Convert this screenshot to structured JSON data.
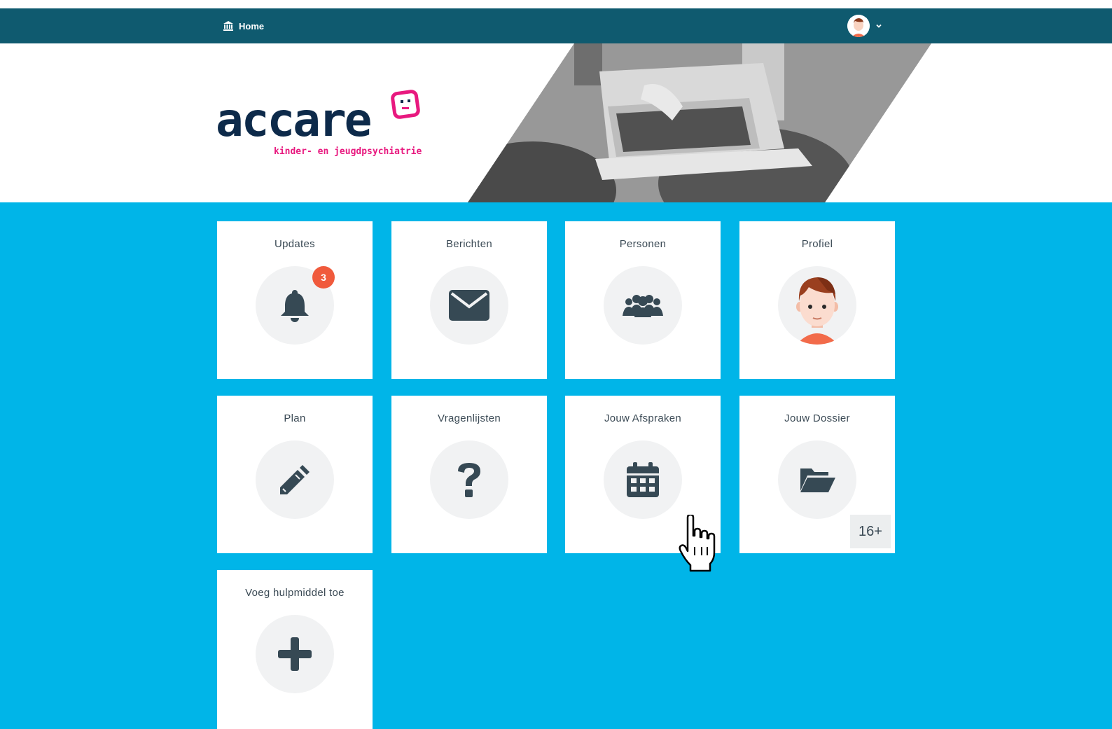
{
  "nav": {
    "home_label": "Home",
    "home_icon": "building-icon",
    "account_icon": "avatar-icon",
    "dropdown_icon": "chevron-down-icon",
    "bg_color": "#0f5a6f"
  },
  "brand": {
    "logo_text": "accare",
    "tagline": "kinder- en jeugdpsychiatrie",
    "primary_color": "#0d2a4a",
    "accent_color": "#e8197f"
  },
  "main": {
    "bg_color": "#00b5e8",
    "tiles": [
      {
        "title": "Updates",
        "icon": "bell-icon",
        "badge": "3"
      },
      {
        "title": "Berichten",
        "icon": "envelope-icon"
      },
      {
        "title": "Personen",
        "icon": "people-group-icon"
      },
      {
        "title": "Profiel",
        "icon": "profile-avatar-icon"
      },
      {
        "title": "Plan",
        "icon": "pencil-icon"
      },
      {
        "title": "Vragenlijsten",
        "icon": "question-icon"
      },
      {
        "title": "Jouw Afspraken",
        "icon": "calendar-icon"
      },
      {
        "title": "Jouw Dossier",
        "icon": "folder-open-icon",
        "age_label": "16+"
      },
      {
        "title": "Voeg hulpmiddel toe",
        "icon": "plus-icon"
      }
    ]
  }
}
